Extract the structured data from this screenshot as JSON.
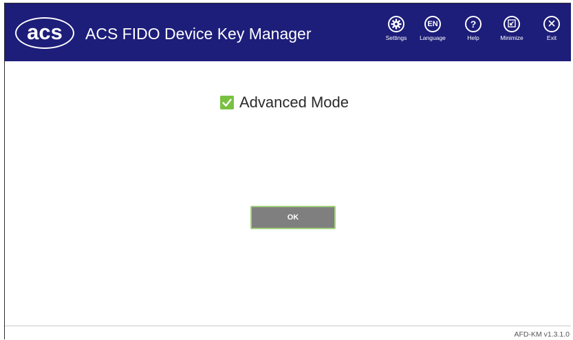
{
  "header": {
    "logo_text": "acs",
    "title": "ACS FIDO Device Key Manager",
    "background_color": "#1d1d7a"
  },
  "toolbar": {
    "settings": {
      "label": "Settings",
      "icon": "gear-icon"
    },
    "language": {
      "label": "Language",
      "icon_text": "EN"
    },
    "help": {
      "label": "Help",
      "icon_text": "?"
    },
    "minimize": {
      "label": "Minimize",
      "icon": "minimize-icon"
    },
    "exit": {
      "label": "Exit",
      "icon": "close-icon"
    }
  },
  "main": {
    "advanced_mode": {
      "label": "Advanced Mode",
      "checked": true,
      "check_color": "#7ac142"
    },
    "ok_button": {
      "label": "OK",
      "background_color": "#7f7f7f",
      "border_color": "#a3d17c"
    }
  },
  "footer": {
    "version": "AFD-KM v1.3.1.0"
  }
}
